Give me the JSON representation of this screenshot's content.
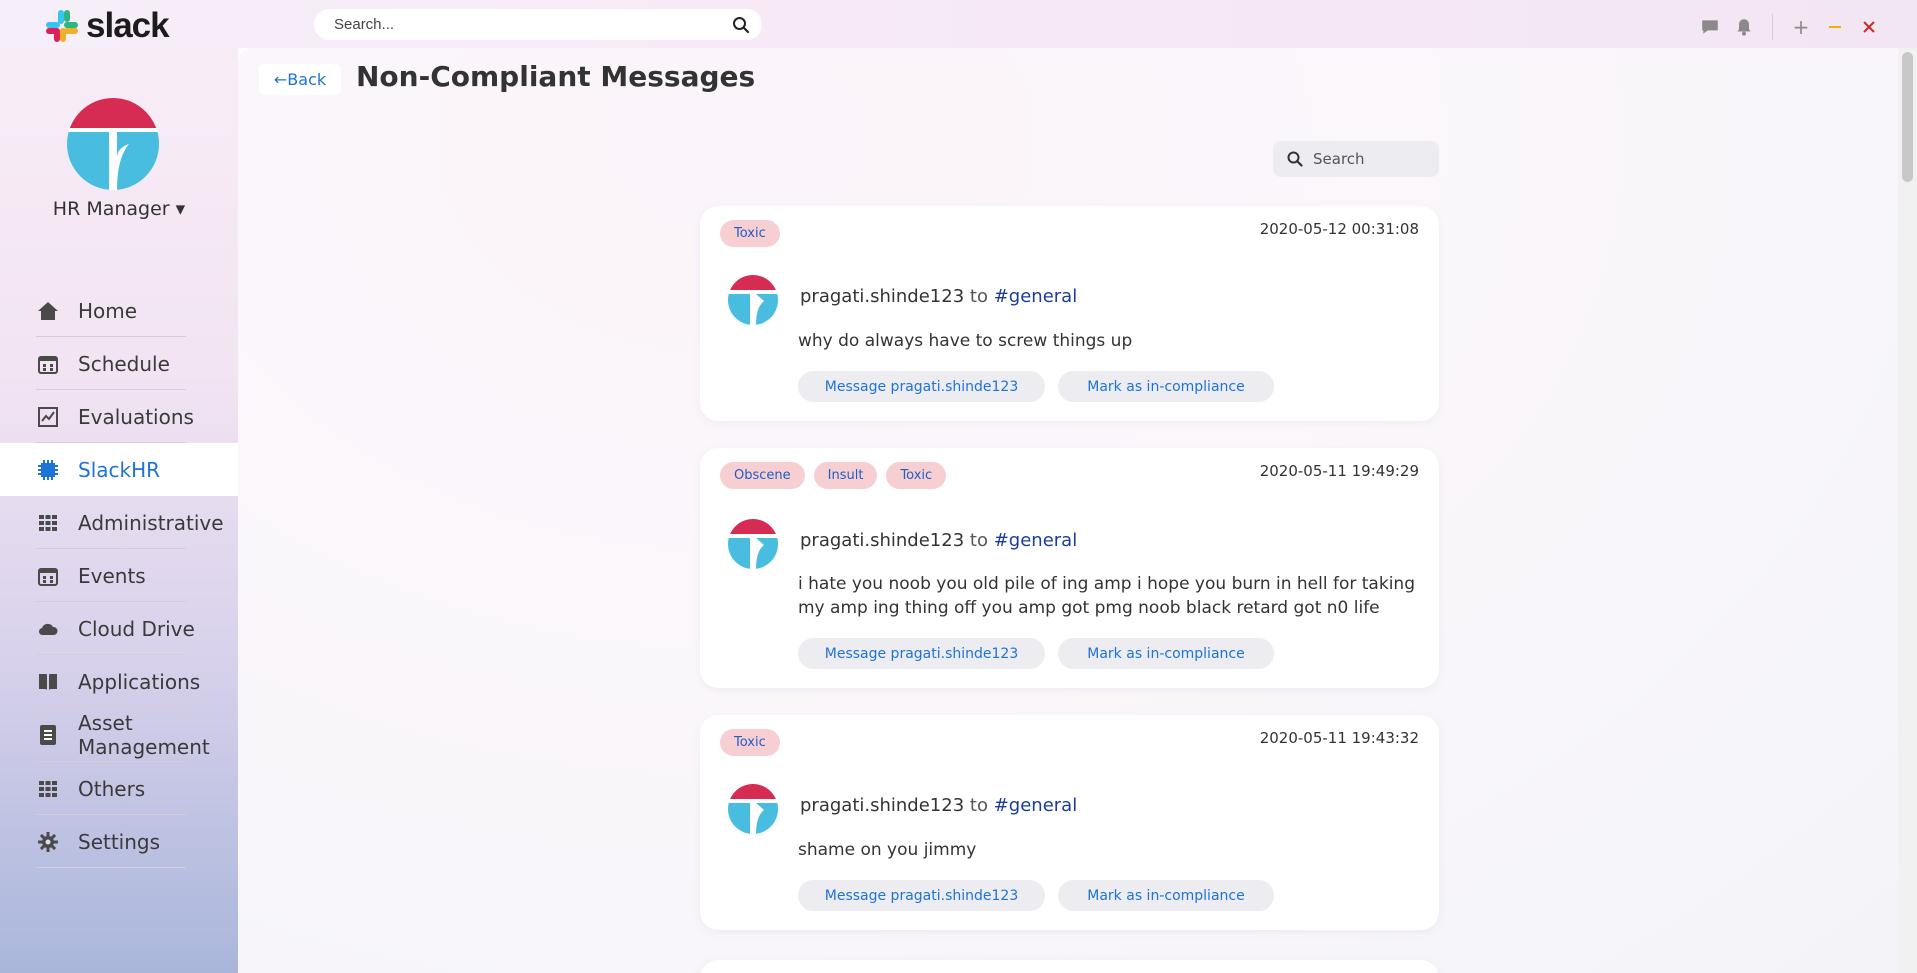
{
  "app": {
    "logo_text": "slack",
    "search_placeholder": "Search...",
    "brand_colors": {
      "red": "#d2284f",
      "blue": "#48bde0",
      "accent": "#1d74d6"
    }
  },
  "window_controls": [
    "chat-icon",
    "bell-icon",
    "plus-icon",
    "minimize-icon",
    "close-icon"
  ],
  "sidebar": {
    "user_name": "HR Manager ▾",
    "items": [
      {
        "label": "Home",
        "icon": "home-icon"
      },
      {
        "label": "Schedule",
        "icon": "calendar-icon"
      },
      {
        "label": "Evaluations",
        "icon": "chart-icon"
      },
      {
        "label": "SlackHR",
        "icon": "chip-icon",
        "active": true
      },
      {
        "label": "Administrative",
        "icon": "grid-icon"
      },
      {
        "label": "Events",
        "icon": "calendar-icon"
      },
      {
        "label": "Cloud Drive",
        "icon": "cloud-icon"
      },
      {
        "label": "Applications",
        "icon": "book-icon"
      },
      {
        "label": "Asset Management",
        "label_line1": "Asset",
        "label_line2": "Management",
        "icon": "list-icon"
      },
      {
        "label": "Others",
        "icon": "grid-icon"
      },
      {
        "label": "Settings",
        "icon": "gear-icon"
      }
    ]
  },
  "main": {
    "back_label": "←Back",
    "title": "Non-Compliant Messages",
    "search_placeholder": "Search",
    "messages": [
      {
        "tags": [
          "Toxic"
        ],
        "timestamp": "2020-05-12 00:31:08",
        "user": "pragati.shinde123",
        "to": "to",
        "channel": "#general",
        "text": "why do always have to screw things up",
        "message_button": "Message pragati.shinde123",
        "mark_button": "Mark as in-compliance"
      },
      {
        "tags": [
          "Obscene",
          "Insult",
          "Toxic"
        ],
        "timestamp": "2020-05-11 19:49:29",
        "user": "pragati.shinde123",
        "to": "to",
        "channel": "#general",
        "text": "i hate you noob you old pile of ing amp i hope you burn in hell for taking my amp ing thing off you amp got pmg noob black retard got n0 life",
        "message_button": "Message pragati.shinde123",
        "mark_button": "Mark as in-compliance"
      },
      {
        "tags": [
          "Toxic"
        ],
        "timestamp": "2020-05-11 19:43:32",
        "user": "pragati.shinde123",
        "to": "to",
        "channel": "#general",
        "text": "shame on you jimmy",
        "message_button": "Message pragati.shinde123",
        "mark_button": "Mark as in-compliance"
      }
    ]
  }
}
